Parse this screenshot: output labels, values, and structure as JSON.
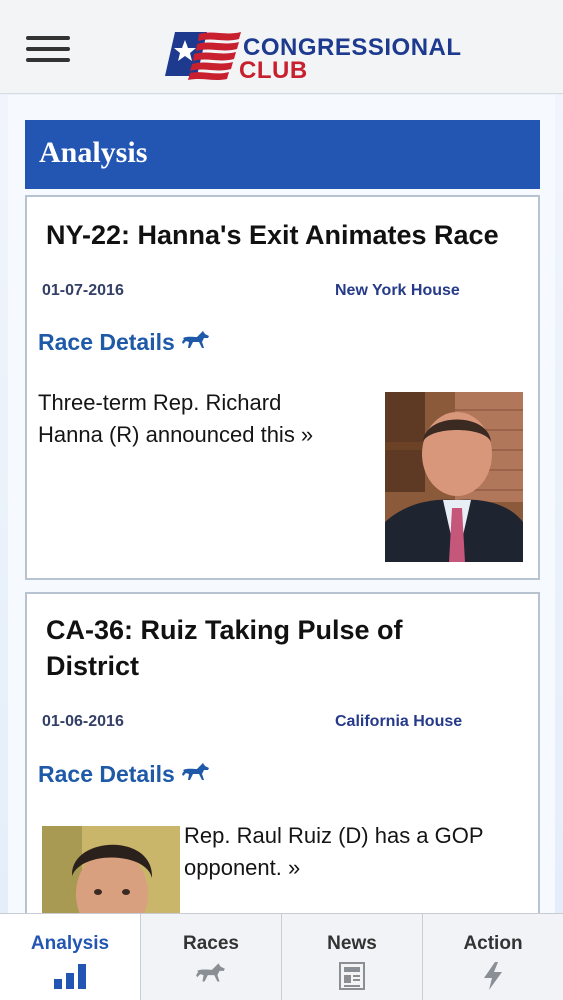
{
  "header": {
    "menu_icon": "hamburger-icon",
    "logo_line1": "CONGRESSIONAL",
    "logo_line2": "CLUB",
    "logo_colors": {
      "blue": "#1d3a8f",
      "red": "#c8202f"
    }
  },
  "section": {
    "title": "Analysis",
    "color": "#2356b3"
  },
  "articles": [
    {
      "title": "NY-22: Hanna's Exit Animates Race",
      "date": "01-07-2016",
      "category": "New York House",
      "race_link": "Race Details",
      "summary": "Three-term Rep. Richard Hanna (R) announced this »"
    },
    {
      "title": "CA-36: Ruiz Taking Pulse of District",
      "date": "01-06-2016",
      "category": "California House",
      "race_link": "Race Details",
      "summary": "Rep. Raul Ruiz (D) has a GOP opponent. »"
    }
  ],
  "tabs": [
    {
      "label": "Analysis",
      "icon": "bar-chart-icon",
      "active": true
    },
    {
      "label": "Races",
      "icon": "horse-icon",
      "active": false
    },
    {
      "label": "News",
      "icon": "newspaper-icon",
      "active": false
    },
    {
      "label": "Action",
      "icon": "lightning-icon",
      "active": false
    }
  ]
}
